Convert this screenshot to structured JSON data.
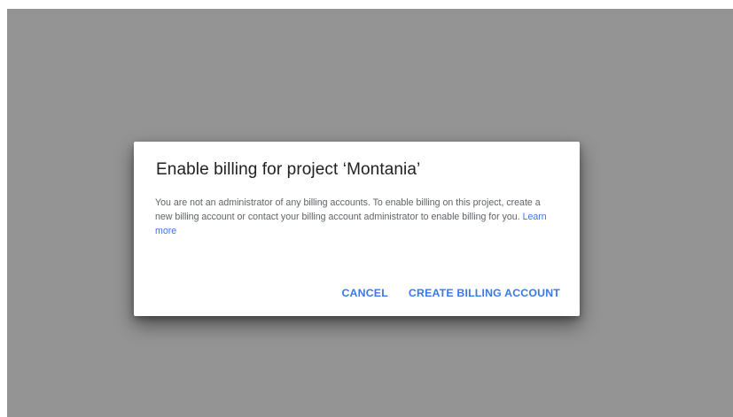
{
  "dialog": {
    "title": "Enable billing for project ‘Montania’",
    "body_text": "You are not an administrator of any billing accounts. To enable billing on this project, create a new billing account or contact your billing account administrator to enable billing for you. ",
    "learn_more_label": "Learn more",
    "cancel_label": "CANCEL",
    "create_label": "CREATE BILLING ACCOUNT"
  },
  "colors": {
    "overlay": "#949494",
    "accent": "#3b78e7",
    "title_text": "#212121",
    "body_text": "#5f6368"
  }
}
